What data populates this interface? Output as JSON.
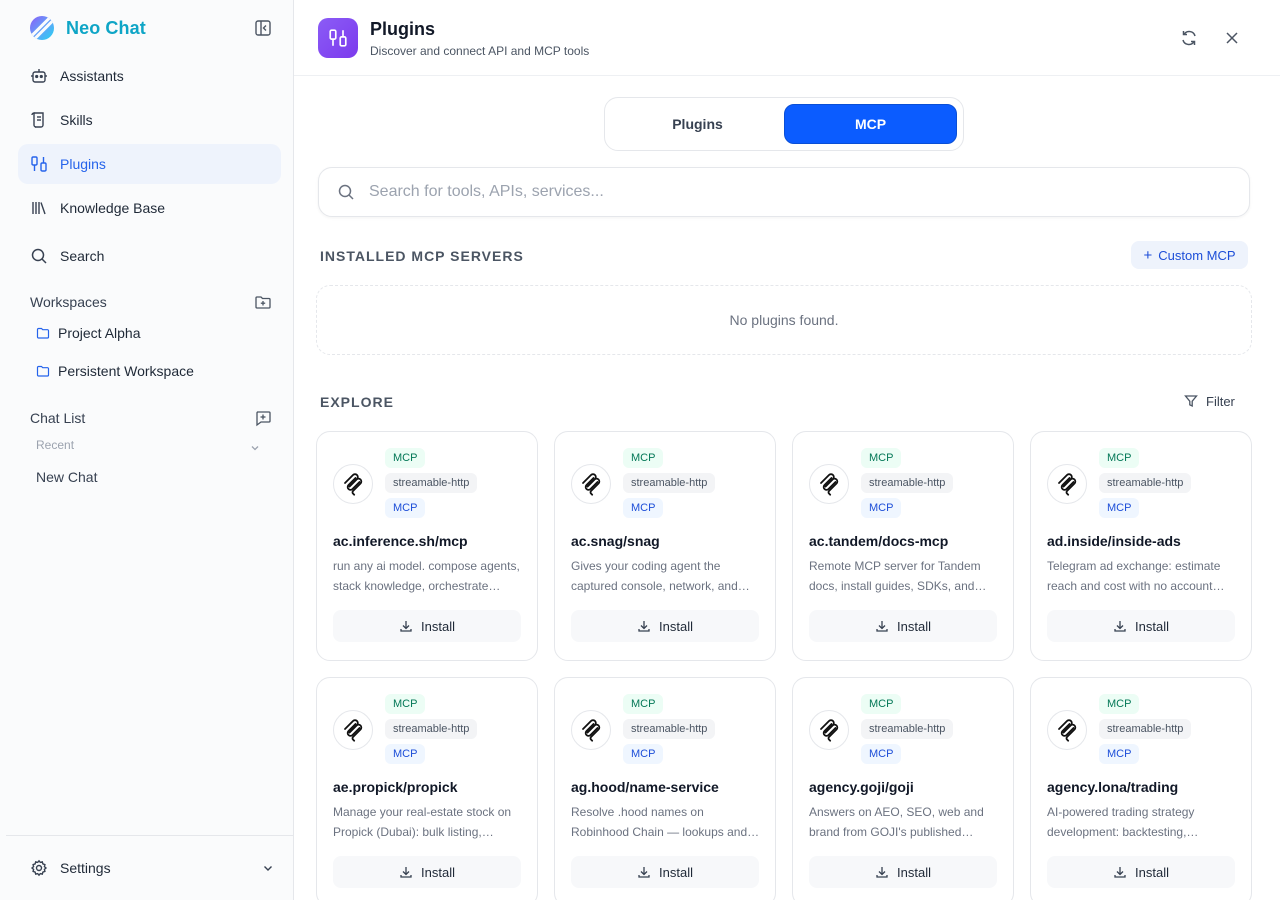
{
  "app": {
    "name": "Neo Chat",
    "brand_color": "#0ea5c6",
    "accent": "#0b5cff"
  },
  "sidebar": {
    "nav": [
      {
        "label": "Assistants",
        "icon": "bot-icon",
        "active": false
      },
      {
        "label": "Skills",
        "icon": "scroll-icon",
        "active": false
      },
      {
        "label": "Plugins",
        "icon": "plug-icon",
        "active": true
      },
      {
        "label": "Knowledge Base",
        "icon": "library-icon",
        "active": false
      },
      {
        "label": "Search",
        "icon": "search-icon",
        "active": false
      }
    ],
    "workspaces": {
      "title": "Workspaces",
      "items": [
        "Project Alpha",
        "Persistent Workspace"
      ]
    },
    "chat_list": {
      "title": "Chat List",
      "group": "Recent",
      "items": [
        "New Chat"
      ]
    },
    "settings_label": "Settings"
  },
  "header": {
    "title": "Plugins",
    "subtitle": "Discover and connect API and MCP tools"
  },
  "tabs": [
    {
      "label": "Plugins",
      "active": false
    },
    {
      "label": "MCP",
      "active": true
    }
  ],
  "search": {
    "placeholder": "Search for tools, APIs, services...",
    "value": ""
  },
  "installed": {
    "title": "INSTALLED MCP SERVERS",
    "custom_label": "Custom MCP",
    "empty_text": "No plugins found."
  },
  "explore": {
    "title": "EXPLORE",
    "filter_label": "Filter",
    "install_label": "Install",
    "cards": [
      {
        "badges": [
          "MCP",
          "streamable-http",
          "MCP"
        ],
        "name": "ac.inference.sh/mcp",
        "desc": "run any ai model. compose agents, stack knowledge, orchestrate workflows"
      },
      {
        "badges": [
          "MCP",
          "streamable-http",
          "MCP"
        ],
        "name": "ac.snag/snag",
        "desc": "Gives your coding agent the captured console, network, and page context"
      },
      {
        "badges": [
          "MCP",
          "streamable-http",
          "MCP"
        ],
        "name": "ac.tandem/docs-mcp",
        "desc": "Remote MCP server for Tandem docs, install guides, SDKs, and examples"
      },
      {
        "badges": [
          "MCP",
          "streamable-http",
          "MCP"
        ],
        "name": "ad.inside/inside-ads",
        "desc": "Telegram ad exchange: estimate reach and cost with no account needed"
      },
      {
        "badges": [
          "MCP",
          "streamable-http",
          "MCP"
        ],
        "name": "ae.propick/propick",
        "desc": "Manage your real-estate stock on Propick (Dubai): bulk listing, updates"
      },
      {
        "badges": [
          "MCP",
          "streamable-http",
          "MCP"
        ],
        "name": "ag.hood/name-service",
        "desc": "Resolve .hood names on Robinhood Chain — lookups and reverse records"
      },
      {
        "badges": [
          "MCP",
          "streamable-http",
          "MCP"
        ],
        "name": "agency.goji/goji",
        "desc": "Answers on AEO, SEO, web and brand from GOJI's published research"
      },
      {
        "badges": [
          "MCP",
          "streamable-http",
          "MCP"
        ],
        "name": "agency.lona/trading",
        "desc": "AI-powered trading strategy development: backtesting, optimization"
      }
    ]
  }
}
